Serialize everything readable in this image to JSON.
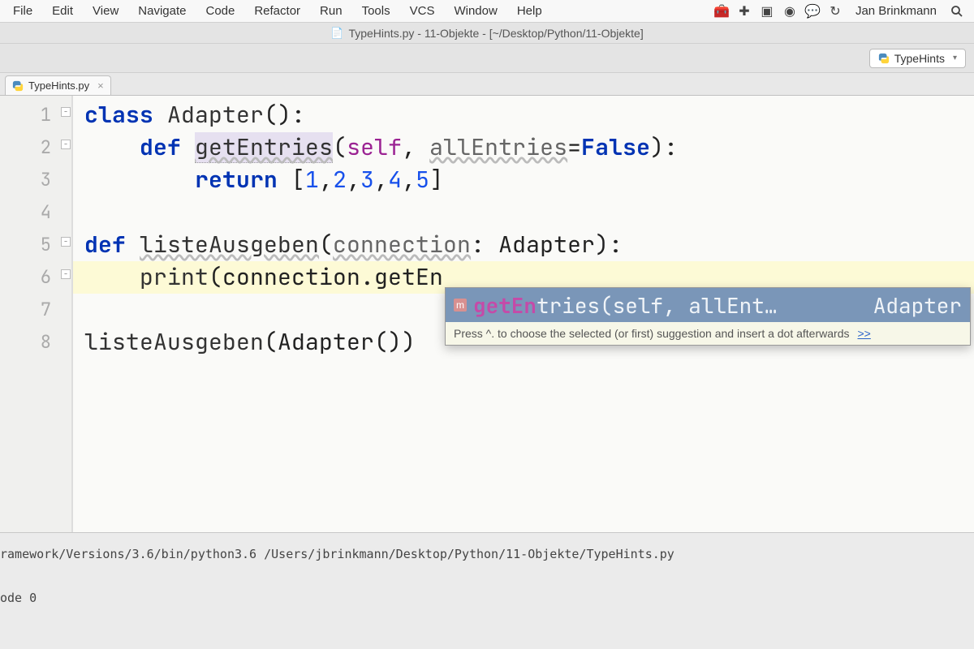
{
  "menubar": {
    "items": [
      "File",
      "Edit",
      "View",
      "Navigate",
      "Code",
      "Refactor",
      "Run",
      "Tools",
      "VCS",
      "Window",
      "Help"
    ],
    "user": "Jan Brinkmann"
  },
  "window": {
    "title": "TypeHints.py - 11-Objekte - [~/Desktop/Python/11-Objekte]"
  },
  "run_config": {
    "name": "TypeHints"
  },
  "tab": {
    "name": "TypeHints.py"
  },
  "code": {
    "lines": [
      {
        "n": "1",
        "tokens": [
          [
            "kw",
            "class "
          ],
          [
            "typ",
            "Adapter"
          ],
          [
            "txt",
            "():"
          ]
        ]
      },
      {
        "n": "2",
        "tokens": [
          [
            "txt",
            "    "
          ],
          [
            "kw",
            "def "
          ],
          [
            "hl-def fn wavy",
            "getEntries"
          ],
          [
            "txt",
            "("
          ],
          [
            "selfp",
            "self"
          ],
          [
            "txt",
            ", "
          ],
          [
            "param wavy",
            "allEntries"
          ],
          [
            "txt",
            "="
          ],
          [
            "bool",
            "False"
          ],
          [
            "txt",
            "):"
          ]
        ]
      },
      {
        "n": "3",
        "tokens": [
          [
            "txt",
            "        "
          ],
          [
            "kw",
            "return "
          ],
          [
            "txt",
            "["
          ],
          [
            "num",
            "1"
          ],
          [
            "txt",
            ","
          ],
          [
            "num",
            "2"
          ],
          [
            "txt",
            ","
          ],
          [
            "num",
            "3"
          ],
          [
            "txt",
            ","
          ],
          [
            "num",
            "4"
          ],
          [
            "txt",
            ","
          ],
          [
            "num",
            "5"
          ],
          [
            "txt",
            "]"
          ]
        ]
      },
      {
        "n": "4",
        "tokens": []
      },
      {
        "n": "5",
        "tokens": [
          [
            "kw",
            "def "
          ],
          [
            "fn wavy",
            "listeAusgeben"
          ],
          [
            "txt",
            "("
          ],
          [
            "param wavy",
            "connection"
          ],
          [
            "txt",
            ": Adapter):"
          ]
        ]
      },
      {
        "n": "6",
        "highlight": true,
        "tokens": [
          [
            "txt",
            "    "
          ],
          [
            "fn",
            "print"
          ],
          [
            "txt",
            "(connection."
          ],
          [
            "txt",
            "getEn"
          ]
        ]
      },
      {
        "n": "7",
        "tokens": []
      },
      {
        "n": "8",
        "tokens": [
          [
            "fn",
            "listeAusgeben"
          ],
          [
            "txt",
            "(Adapter())"
          ]
        ]
      }
    ]
  },
  "autocomplete": {
    "badge": "m",
    "match": "getEn",
    "rest": "tries(self, allEnt…",
    "type": "Adapter",
    "hint": "Press ^. to choose the selected (or first) suggestion and insert a dot afterwards",
    "hint_link": ">>"
  },
  "console": {
    "line1": "ramework/Versions/3.6/bin/python3.6 /Users/jbrinkmann/Desktop/Python/11-Objekte/TypeHints.py",
    "line2": "ode 0"
  }
}
